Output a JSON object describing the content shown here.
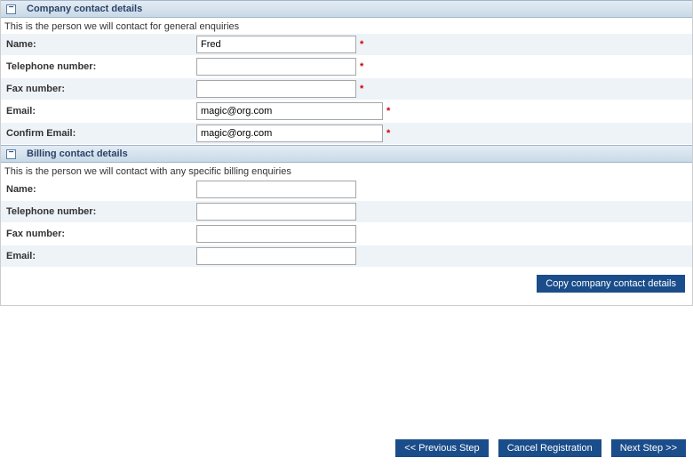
{
  "company": {
    "header": "Company contact details",
    "desc": "This is the person we will contact for general enquiries",
    "name_label": "Name:",
    "name_value": "Fred",
    "tel_label": "Telephone number:",
    "tel_value": "",
    "fax_label": "Fax number:",
    "fax_value": "",
    "email_label": "Email:",
    "email_value": "magic@org.com",
    "confirm_label": "Confirm Email:",
    "confirm_value": "magic@org.com"
  },
  "billing": {
    "header": "Billing contact details",
    "desc": "This is the person we will contact with any specific billing enquiries",
    "name_label": "Name:",
    "name_value": "",
    "tel_label": "Telephone number:",
    "tel_value": "",
    "fax_label": "Fax number:",
    "fax_value": "",
    "email_label": "Email:",
    "email_value": ""
  },
  "buttons": {
    "copy": "Copy company contact details",
    "prev": "<< Previous Step",
    "cancel": "Cancel Registration",
    "next": "Next Step >>"
  },
  "required_mark": "*"
}
